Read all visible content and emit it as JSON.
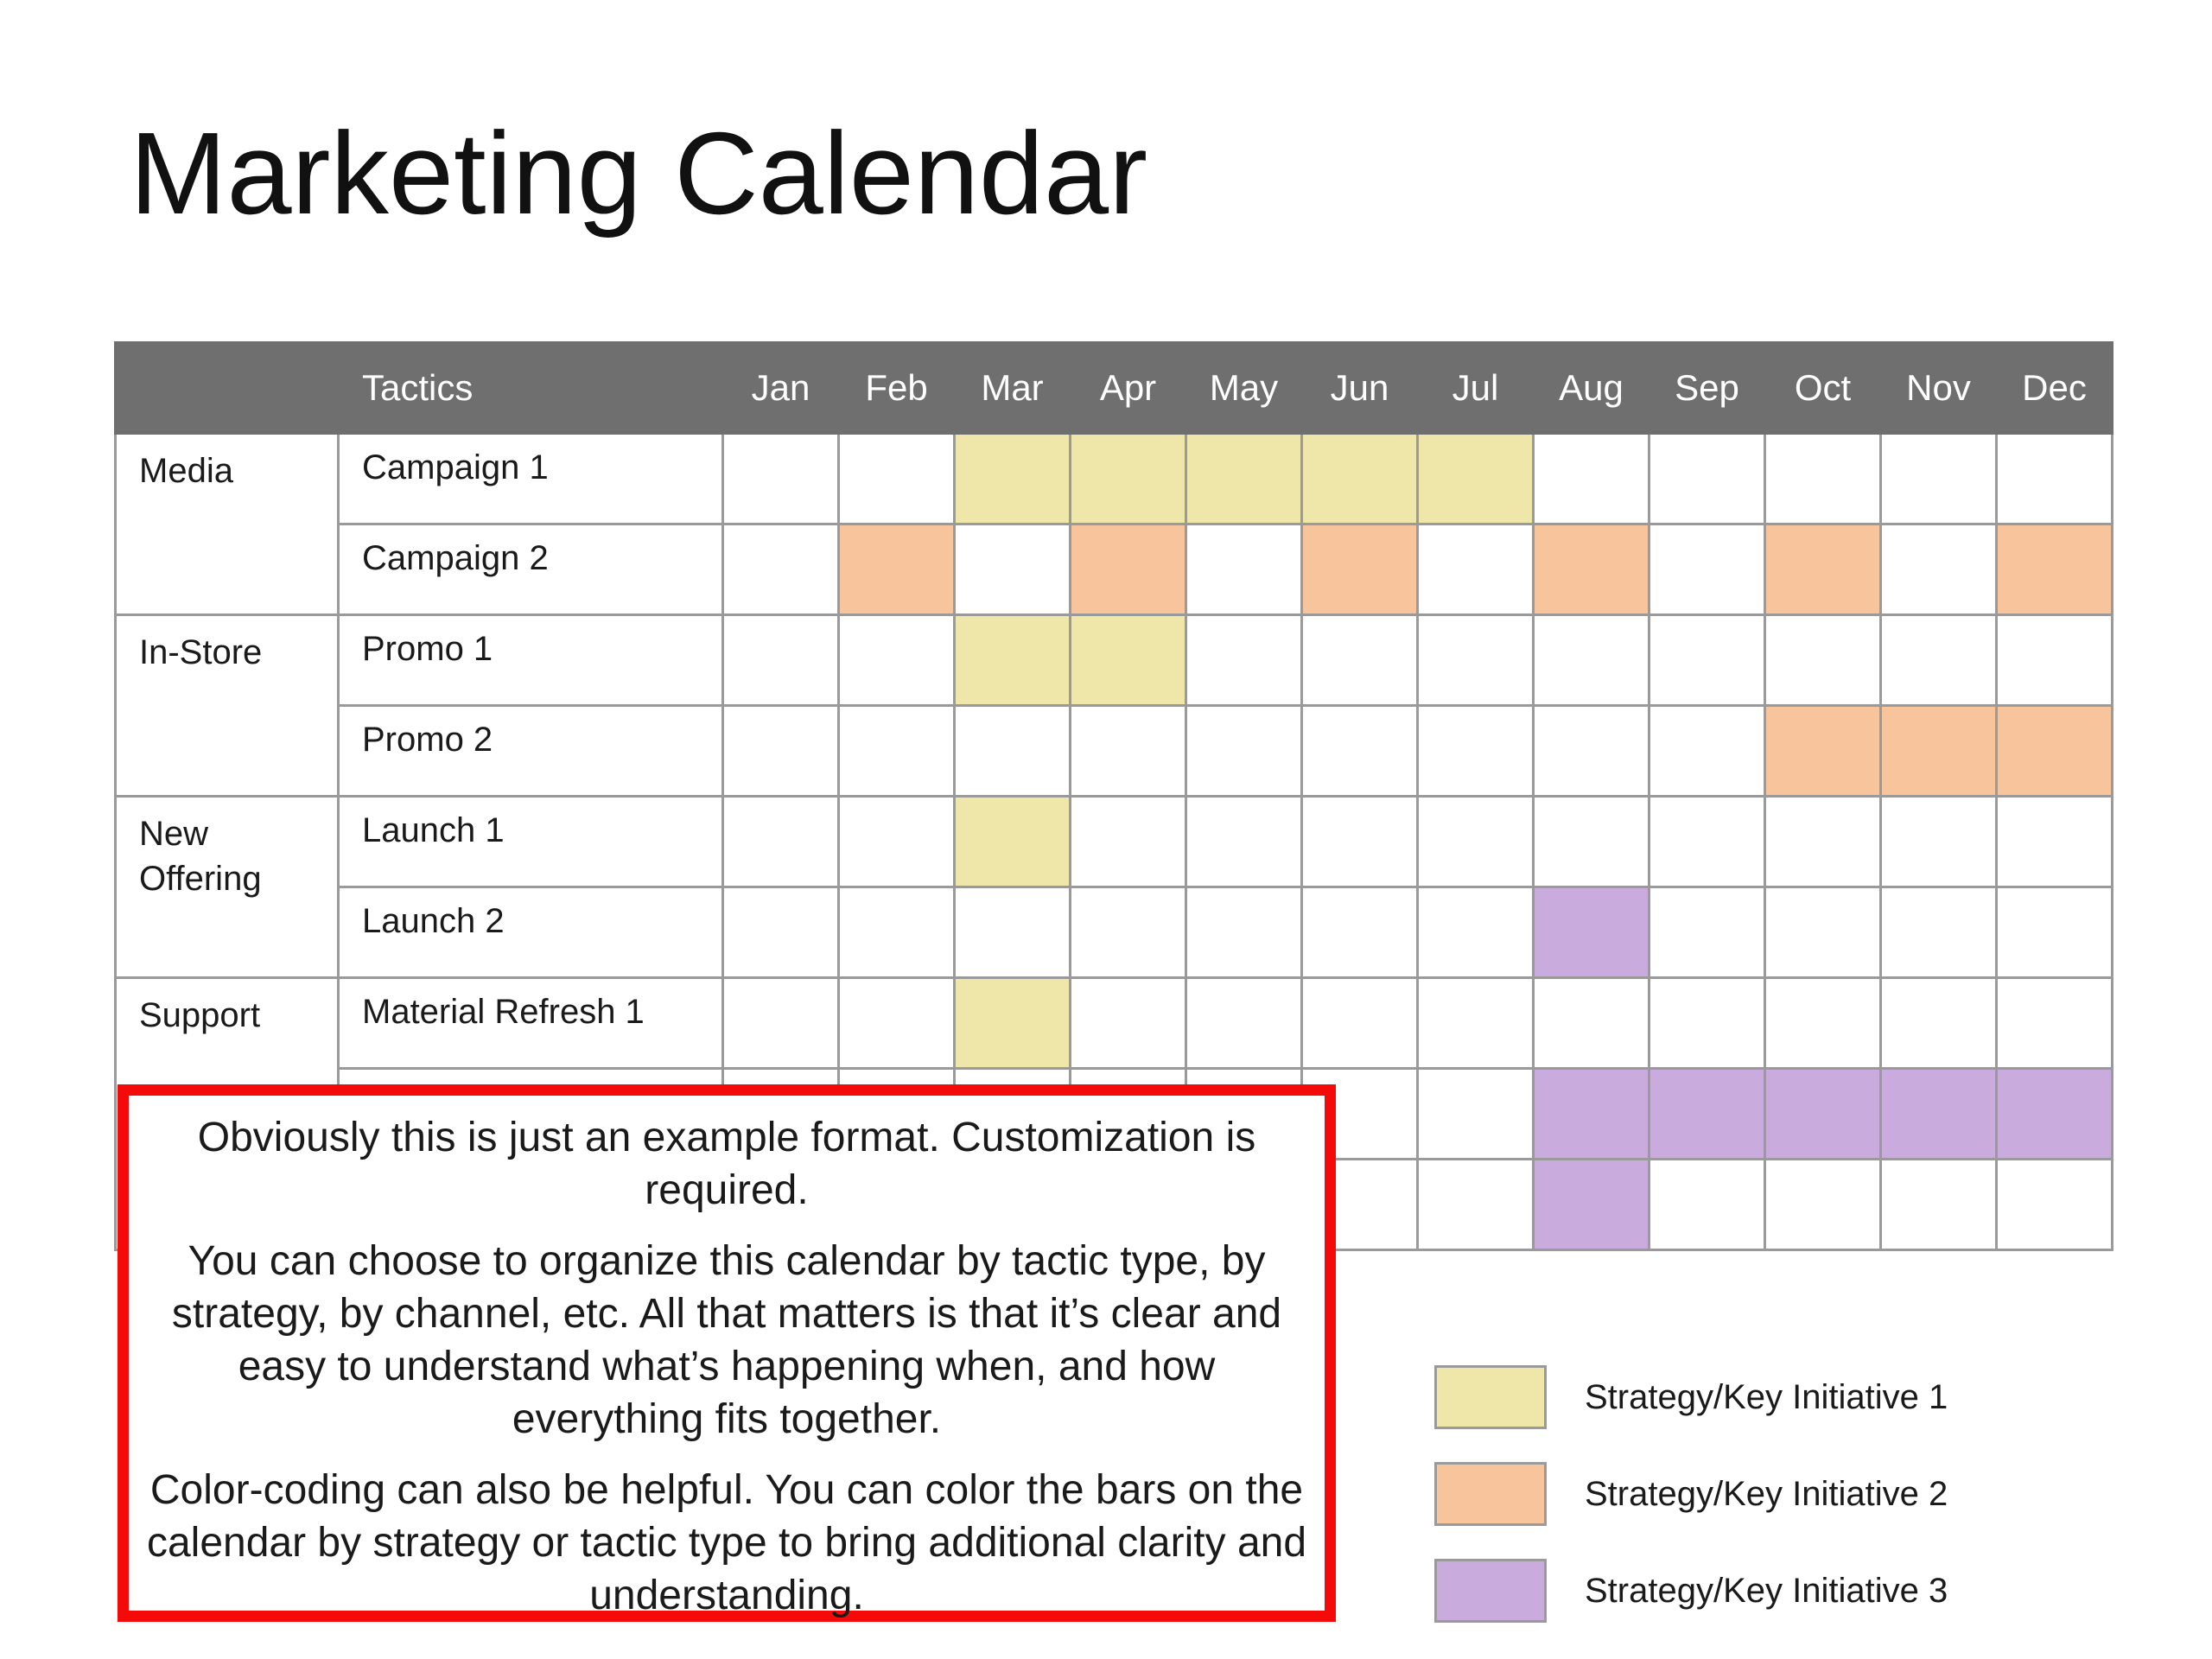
{
  "page": {
    "title": "Marketing Calendar"
  },
  "calendar": {
    "header": {
      "tactics_label": "Tactics",
      "months": [
        "Jan",
        "Feb",
        "Mar",
        "Apr",
        "May",
        "Jun",
        "Jul",
        "Aug",
        "Sep",
        "Oct",
        "Nov",
        "Dec"
      ]
    },
    "colors": {
      "initiative_1": "#efe6a9",
      "initiative_2": "#f7c49b",
      "initiative_3": "#c9abdd",
      "header_bg": "#6f6f6f"
    },
    "groups": [
      {
        "strategy": "Media",
        "rows": [
          {
            "tactic": "Campaign 1",
            "cells": [
              "",
              "",
              "y",
              "y",
              "y",
              "y",
              "y",
              "",
              "",
              "",
              "",
              ""
            ]
          },
          {
            "tactic": "Campaign 2",
            "cells": [
              "",
              "o",
              "",
              "o",
              "",
              "o",
              "",
              "o",
              "",
              "o",
              "",
              "o"
            ]
          }
        ]
      },
      {
        "strategy": "In-Store",
        "rows": [
          {
            "tactic": "Promo 1",
            "cells": [
              "",
              "",
              "y",
              "y",
              "",
              "",
              "",
              "",
              "",
              "",
              "",
              ""
            ]
          },
          {
            "tactic": "Promo 2",
            "cells": [
              "",
              "",
              "",
              "",
              "",
              "",
              "",
              "",
              "",
              "o",
              "o",
              "o"
            ]
          }
        ]
      },
      {
        "strategy": "New Offering",
        "rows": [
          {
            "tactic": "Launch 1",
            "cells": [
              "",
              "",
              "y",
              "",
              "",
              "",
              "",
              "",
              "",
              "",
              "",
              ""
            ]
          },
          {
            "tactic": "Launch 2",
            "cells": [
              "",
              "",
              "",
              "",
              "",
              "",
              "",
              "p",
              "",
              "",
              "",
              ""
            ]
          }
        ]
      },
      {
        "strategy": "Support",
        "rows": [
          {
            "tactic": "Material Refresh 1",
            "cells": [
              "",
              "",
              "y",
              "",
              "",
              "",
              "",
              "",
              "",
              "",
              "",
              ""
            ]
          },
          {
            "tactic": "",
            "cells": [
              "",
              "",
              "",
              "",
              "",
              "",
              "",
              "p",
              "p",
              "p",
              "p",
              "p"
            ]
          },
          {
            "tactic": "",
            "cells": [
              "",
              "",
              "",
              "",
              "",
              "",
              "",
              "p",
              "",
              "",
              "",
              ""
            ]
          }
        ]
      }
    ]
  },
  "note": {
    "paragraphs": [
      "Obviously this is just an example format. Customization is required.",
      "You can choose to organize this calendar by tactic type, by strategy, by channel, etc. All that matters is that it’s clear and easy to understand what’s happening when, and how everything fits together.",
      "Color-coding can also be helpful. You can color the bars on the calendar by strategy or tactic type to bring additional clarity and understanding."
    ]
  },
  "legend": {
    "items": [
      {
        "label": "Strategy/Key Initiative 1",
        "color": "#efe6a9"
      },
      {
        "label": "Strategy/Key Initiative 2",
        "color": "#f7c49b"
      },
      {
        "label": "Strategy/Key Initiative 3",
        "color": "#c9abdd"
      }
    ]
  }
}
